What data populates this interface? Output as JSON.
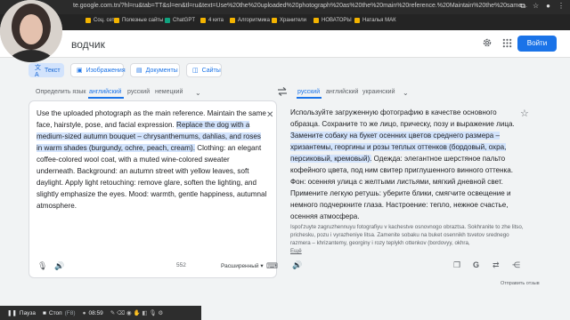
{
  "browser": {
    "url": "te.google.com.tn/?hl=ru&tab=TT&sl=en&tl=ru&text=Use%20the%20uploaded%20photograph%20as%20the%20main%20reference.%20Maintain%20the%20same...",
    "bookmarks": [
      "Соц. сети",
      "Полезные сайты",
      "ChatGPT",
      "4 кита",
      "Алгоритмика",
      "Хранители",
      "НОВАТОРЫ",
      "Наталья МАК"
    ]
  },
  "header": {
    "title": "водчик",
    "login_label": "Войти"
  },
  "modes": [
    "Текст",
    "Изображения",
    "Документы",
    "Сайты"
  ],
  "source_langs": [
    "Определить язык",
    "английский",
    "русский",
    "немецкий"
  ],
  "target_langs": [
    "русский",
    "английский",
    "украинский"
  ],
  "source": {
    "text_before": "Use the uploaded photograph as the main reference. Maintain the same face, hairstyle, pose, and facial expression. ",
    "text_highlight": "Replace the dog with a medium-sized autumn bouquet – chrysanthemums, dahlias, and roses in warm shades (burgundy, ochre, peach, cream).",
    "text_after": " Clothing: an elegant coffee-colored wool coat, with a muted wine-colored sweater underneath. Background: an autumn street with yellow leaves, soft daylight. Apply light retouching: remove glare, soften the lighting, and slightly emphasize the eyes. Mood: warmth, gentle happiness, autumnal atmosphere.",
    "char_count": "552",
    "mode_label": "Расширенный"
  },
  "target": {
    "text_before": "Используйте загруженную фотографию в качестве основного образца. Сохраните то же лицо, прическу, позу и выражение лица. ",
    "text_highlight": "Замените собаку на букет осенних цветов среднего размера – хризантемы, георгины и розы теплых оттенков (бордовый, охра, персиковый, кремовый).",
    "text_after": " Одежда: элегантное шерстяное пальто кофейного цвета, под ним свитер приглушенного винного оттенка. Фон: осенняя улица с желтыми листьями, мягкий дневной свет. Примените легкую ретушь: уберите блики, смягчите освещение и немного подчеркните глаза. Настроение: тепло, нежное счастье, осенняя атмосфера.",
    "transliteration": "Ispol'zuyte zagruzhennuyu fotografiyu v kachestve osnovnogo obraztsa. Sokhranite to zhe litso, prichesku, pozu i vyrazheniye litsa. Zamenite sobaku na buket osennikh tsvetov srednego razmera – khrizantemy, georginy i rozy teplykh ottenkov (bordovyy, okhra,",
    "more_label": "Ещё"
  },
  "feedback_label": "Отправить отзыв",
  "taskbar": {
    "pause_label": "Пауза",
    "stop_label": "Стоп",
    "stop_hotkey": "(F8)",
    "time": "08:59"
  },
  "colors": {
    "accent": "#1a73e8",
    "highlight": "#d2e3fc"
  }
}
